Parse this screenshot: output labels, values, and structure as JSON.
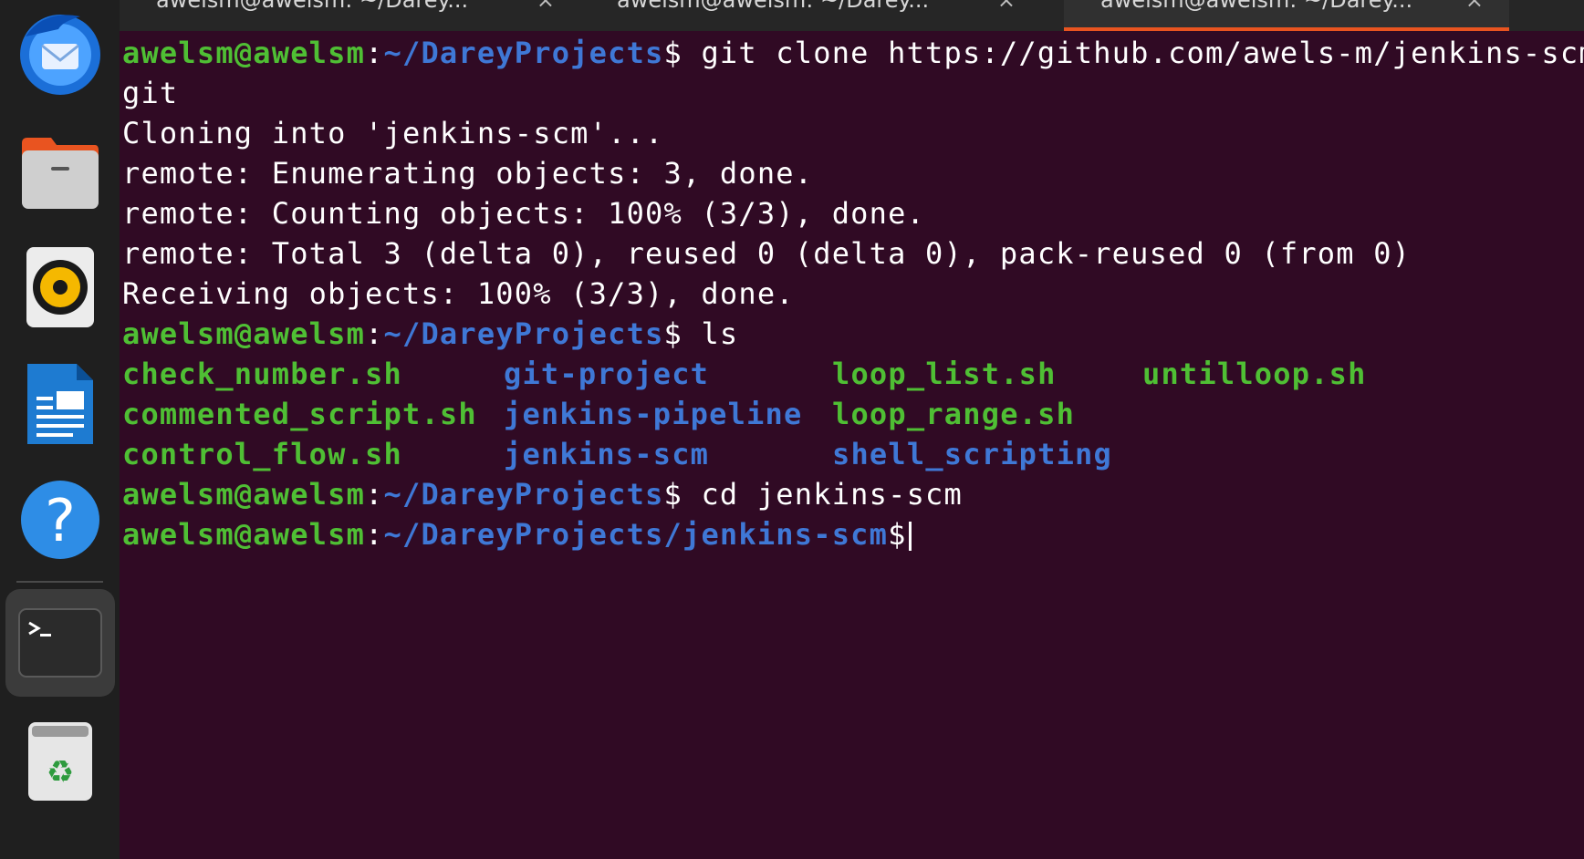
{
  "dock": {
    "apps": [
      {
        "name": "thunderbird-icon"
      },
      {
        "name": "files-icon"
      },
      {
        "name": "rhythmbox-icon"
      },
      {
        "name": "writer-icon"
      },
      {
        "name": "help-icon"
      },
      {
        "name": "terminal-icon"
      },
      {
        "name": "trash-icon"
      }
    ]
  },
  "tabs": [
    {
      "label": "awelsm@awelsm: ~/Darey..."
    },
    {
      "label": "awelsm@awelsm: ~/Darey..."
    },
    {
      "label": "awelsm@awelsm: ~/Darey..."
    }
  ],
  "tab_close": "×",
  "terminal": {
    "prompt_user": "awelsm@awelsm",
    "prompt_path": "~/DareyProjects",
    "prompt_path_scm": "~/DareyProjects/jenkins-scm",
    "cmd1": " git clone https://github.com/awels-m/jenkins-scm.",
    "cmd1_wrap": "git",
    "out1": "Cloning into 'jenkins-scm'...",
    "out2": "remote: Enumerating objects: 3, done.",
    "out3": "remote: Counting objects: 100% (3/3), done.",
    "out4": "remote: Total 3 (delta 0), reused 0 (delta 0), pack-reused 0 (from 0)",
    "out5": "Receiving objects: 100% (3/3), done.",
    "cmd2": " ls",
    "ls_rows": [
      [
        "check_number.sh",
        "git-project",
        "loop_list.sh",
        "untilloop.sh"
      ],
      [
        "commented_script.sh",
        "jenkins-pipeline",
        "loop_range.sh",
        ""
      ],
      [
        "control_flow.sh",
        "jenkins-scm",
        "shell_scripting",
        ""
      ]
    ],
    "cmd3": " cd jenkins-scm",
    "colon": ":",
    "dollar": "$"
  }
}
